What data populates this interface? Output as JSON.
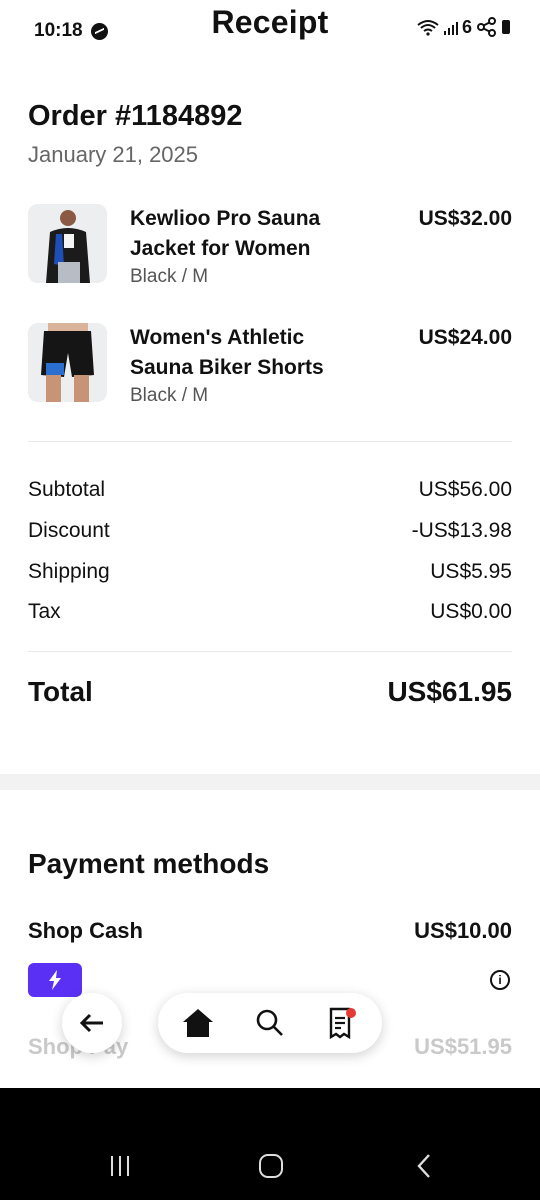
{
  "status_bar": {
    "time": "10:18",
    "battery": "6"
  },
  "header": {
    "title": "Receipt"
  },
  "order": {
    "number": "Order #1184892",
    "date": "January 21, 2025"
  },
  "items": [
    {
      "name": "Kewlioo Pro Sauna Jacket for Women",
      "variant": "Black / M",
      "price": "US$32.00"
    },
    {
      "name": "Women's Athletic Sauna Biker Shorts",
      "variant": "Black / M",
      "price": "US$24.00"
    }
  ],
  "summary": {
    "subtotal_label": "Subtotal",
    "subtotal_value": "US$56.00",
    "discount_label": "Discount",
    "discount_value": "-US$13.98",
    "shipping_label": "Shipping",
    "shipping_value": "US$5.95",
    "tax_label": "Tax",
    "tax_value": "US$0.00",
    "total_label": "Total",
    "total_value": "US$61.95"
  },
  "payments": {
    "title": "Payment methods",
    "shop_cash_label": "Shop Cash",
    "shop_cash_value": "US$10.00",
    "shop_pay_label": "Shop Pay",
    "shop_pay_value": "US$51.95"
  },
  "icons": {
    "back": "arrow-left-icon",
    "home": "home-icon",
    "search": "search-icon",
    "orders": "receipt-icon",
    "lightning": "lightning-icon",
    "info": "info-icon"
  },
  "colors": {
    "shop_cash_badge": "#5a31f4",
    "notification_dot": "#e53935"
  }
}
